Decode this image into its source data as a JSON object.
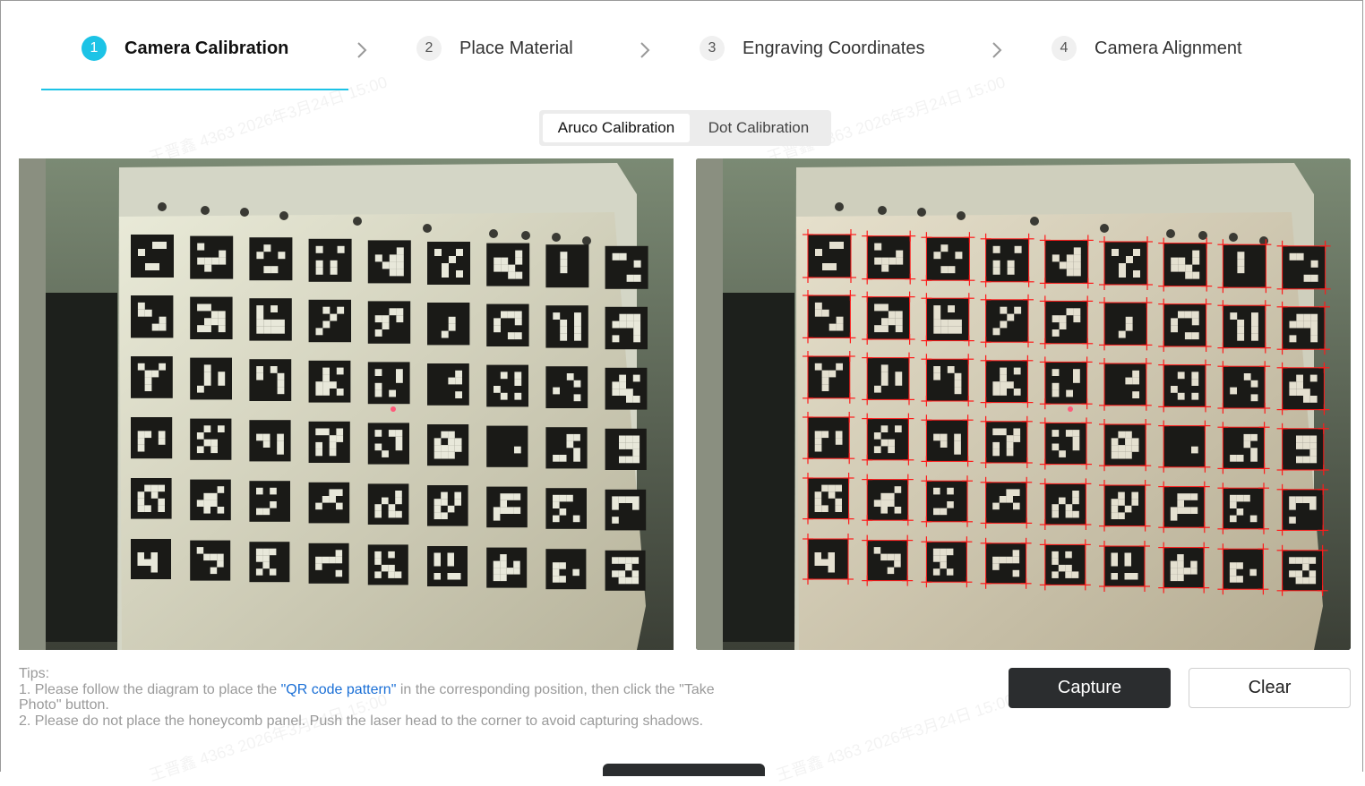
{
  "steps": [
    {
      "num": "1",
      "label": "Camera Calibration",
      "active": true
    },
    {
      "num": "2",
      "label": "Place Material",
      "active": false
    },
    {
      "num": "3",
      "label": "Engraving Coordinates",
      "active": false
    },
    {
      "num": "4",
      "label": "Camera Alignment",
      "active": false
    }
  ],
  "tabs": {
    "aruco": "Aruco Calibration",
    "dot": "Dot Calibration",
    "selected": "Aruco Calibration"
  },
  "images": {
    "left_alt": "Camera photo of ArUco marker calibration board",
    "right_alt": "Undistorted photo with detected marker corners",
    "marker_grid": {
      "rows": 6,
      "cols": 9
    },
    "detected_corner_color": "#ff1a1a"
  },
  "tips": {
    "heading": "Tips:",
    "line1_pre": "1. Please follow the diagram to place the ",
    "line1_link": "\"QR code pattern\"",
    "line1_post": " in the corresponding position, then click the \"Take Photo\" button.",
    "line2": "2. Please do not place the honeycomb panel. Push the laser head to the corner to avoid capturing shadows."
  },
  "buttons": {
    "capture": "Capture",
    "clear": "Clear"
  },
  "watermark": "王晋鑫 4363 2026年3月24日 15:00",
  "colors": {
    "accent": "#1cc3e6",
    "primary_button": "#2b2d2f",
    "link": "#1a6fd6"
  }
}
